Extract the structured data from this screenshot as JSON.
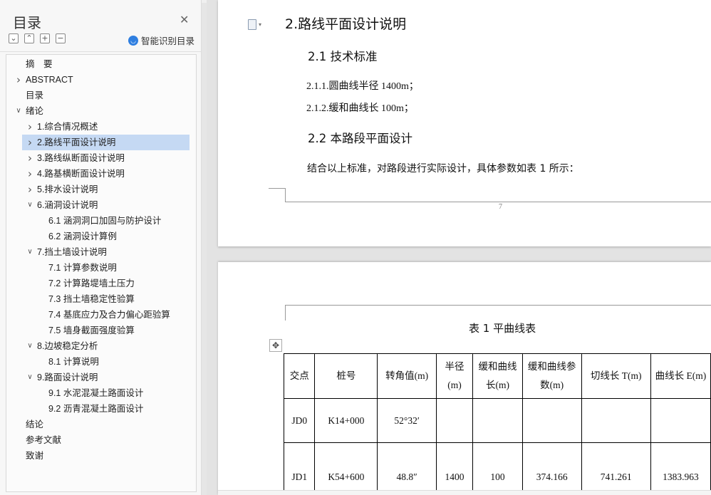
{
  "sidebar": {
    "title": "目录",
    "smart_toc_label": "智能识别目录",
    "tools": [
      "chevron-down",
      "chevron-up",
      "plus",
      "minus"
    ],
    "items": [
      {
        "label": "摘　要",
        "level": 1,
        "chevron": ""
      },
      {
        "label": "ABSTRACT",
        "level": 1,
        "chevron": "right"
      },
      {
        "label": "目录",
        "level": 1,
        "chevron": ""
      },
      {
        "label": "绪论",
        "level": 1,
        "chevron": "down"
      },
      {
        "label": "1.综合情况概述",
        "level": 2,
        "chevron": "right"
      },
      {
        "label": "2.路线平面设计说明",
        "level": 2,
        "chevron": "right",
        "selected": true
      },
      {
        "label": "3.路线纵断面设计说明",
        "level": 2,
        "chevron": "right"
      },
      {
        "label": "4.路基横断面设计说明",
        "level": 2,
        "chevron": "right"
      },
      {
        "label": "5.排水设计说明",
        "level": 2,
        "chevron": "right"
      },
      {
        "label": "6.涵洞设计说明",
        "level": 2,
        "chevron": "down"
      },
      {
        "label": "6.1  涵洞洞口加固与防护设计",
        "level": 3,
        "chevron": ""
      },
      {
        "label": "6.2  涵洞设计算例",
        "level": 3,
        "chevron": ""
      },
      {
        "label": "7.挡土墙设计说明",
        "level": 2,
        "chevron": "down"
      },
      {
        "label": "7.1  计算参数说明",
        "level": 3,
        "chevron": ""
      },
      {
        "label": "7.2  计算路堤墙土压力",
        "level": 3,
        "chevron": ""
      },
      {
        "label": "7.3  挡土墙稳定性验算",
        "level": 3,
        "chevron": ""
      },
      {
        "label": "7.4  基底应力及合力偏心距验算",
        "level": 3,
        "chevron": ""
      },
      {
        "label": "7.5 墙身截面强度验算",
        "level": 3,
        "chevron": ""
      },
      {
        "label": "8.边坡稳定分析",
        "level": 2,
        "chevron": "down"
      },
      {
        "label": "8.1 计算说明",
        "level": 3,
        "chevron": ""
      },
      {
        "label": "9.路面设计说明",
        "level": 2,
        "chevron": "down"
      },
      {
        "label": "9.1  水泥混凝土路面设计",
        "level": 3,
        "chevron": ""
      },
      {
        "label": "9.2  沥青混凝土路面设计",
        "level": 3,
        "chevron": ""
      },
      {
        "label": "结论",
        "level": 1,
        "chevron": ""
      },
      {
        "label": "参考文献",
        "level": 1,
        "chevron": ""
      },
      {
        "label": "致谢",
        "level": 1,
        "chevron": ""
      }
    ]
  },
  "document": {
    "heading": "2.路线平面设计说明",
    "sec1_heading": "2.1  技术标准",
    "std1_prefix": "2.1.1.",
    "std1_cn": "圆曲线半径",
    "std1_value": " 1400m；",
    "std2_prefix": "2.1.2.",
    "std2_cn": "缓和曲线长",
    "std2_value": " 100m；",
    "sec2_heading": "2.2  本路段平面设计",
    "paragraph": "结合以上标准，对路段进行实际设计，具体参数如表 1 所示：",
    "page_number": "7",
    "table_caption": "表 1  平曲线表",
    "table": {
      "headers": [
        "交点",
        "桩号",
        "转角值(m)",
        "半径(m)",
        "缓和曲线长(m)",
        "缓和曲线参数(m)",
        "切线长 T(m)",
        "曲线长 E(m)"
      ],
      "rows": [
        [
          "JD0",
          "K14+000",
          "52°32′",
          "",
          "",
          "",
          "",
          ""
        ],
        [
          "JD1",
          "K54+600",
          "48.8″",
          "1400",
          "100",
          "374.166",
          "741.261",
          "1383.963"
        ]
      ]
    }
  }
}
